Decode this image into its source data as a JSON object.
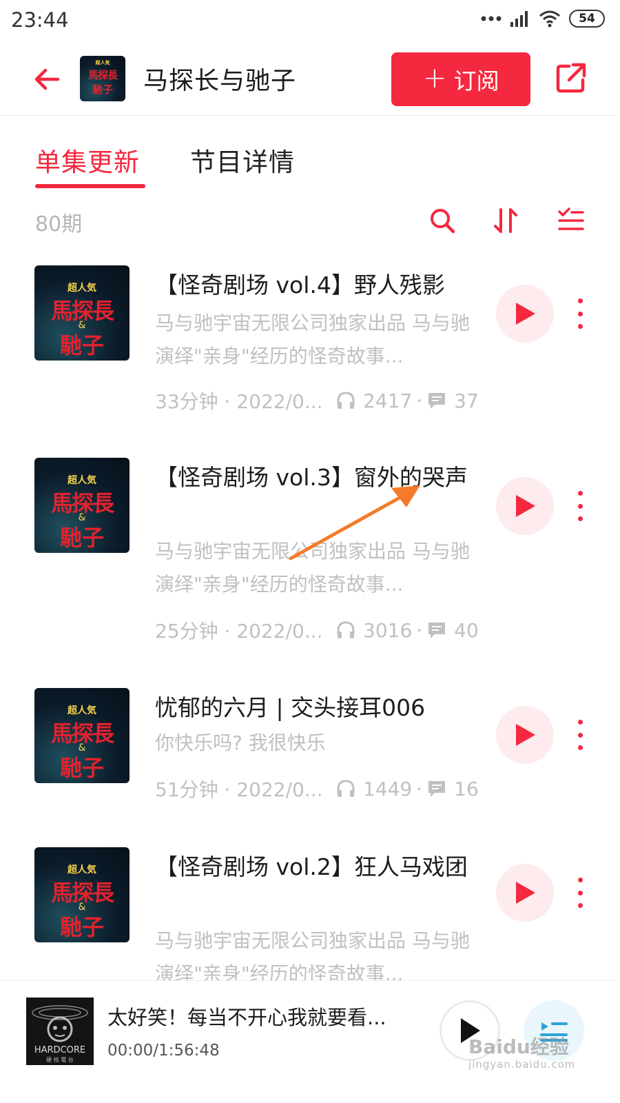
{
  "status_bar": {
    "time": "23:44",
    "battery": "54"
  },
  "header": {
    "title": "马探长与驰子",
    "subscribe_label": "订阅"
  },
  "cover": {
    "line1": "超人気",
    "line2": "馬探長",
    "line3": "&",
    "line4": "馳子"
  },
  "tabs": [
    {
      "label": "单集更新"
    },
    {
      "label": "节目详情"
    }
  ],
  "toolbar": {
    "count": "80期"
  },
  "episodes": [
    {
      "title": "【怪奇剧场 vol.4】野人残影",
      "description": "马与驰宇宙无限公司独家出品 马与驰演绎\"亲身\"经历的怪奇故事...",
      "duration_date": "33分钟 · 2022/0...",
      "plays": "2417",
      "comments": "37"
    },
    {
      "title": "【怪奇剧场 vol.3】窗外的哭声",
      "description": "马与驰宇宙无限公司独家出品 马与驰演绎\"亲身\"经历的怪奇故事...",
      "duration_date": "25分钟 · 2022/0...",
      "plays": "3016",
      "comments": "40"
    },
    {
      "title": "忧郁的六月 | 交头接耳006",
      "description": "你快乐吗? 我很快乐",
      "duration_date": "51分钟 · 2022/0...",
      "plays": "1449",
      "comments": "16"
    },
    {
      "title": "【怪奇剧场 vol.2】狂人马戏团",
      "description": "马与驰宇宙无限公司独家出品 马与驰演绎\"亲身\"经历的怪奇故事...",
      "duration_date": "",
      "plays": "",
      "comments": ""
    }
  ],
  "player": {
    "title": "太好笑！每当不开心我就要看...",
    "time": "00:00/1:56:48",
    "cover_text": "HARDCORE",
    "cover_subtext": "硬 核 電 台"
  },
  "watermark": {
    "main": "Baidu经验",
    "sub": "jingyan.baidu.com"
  },
  "colors": {
    "accent": "#f4283f",
    "play_bg": "#fdebee",
    "muted_text": "#c0c0c0",
    "annotation_arrow": "#f47b2a"
  },
  "icons": {
    "back": "arrow-left-icon",
    "share": "share-external-icon",
    "search": "search-icon",
    "sort": "sort-icon",
    "batch": "batch-select-icon",
    "plays": "headphones-icon",
    "comments": "comment-icon",
    "play": "play-icon",
    "more": "more-vertical-icon",
    "playlist": "playlist-icon"
  }
}
